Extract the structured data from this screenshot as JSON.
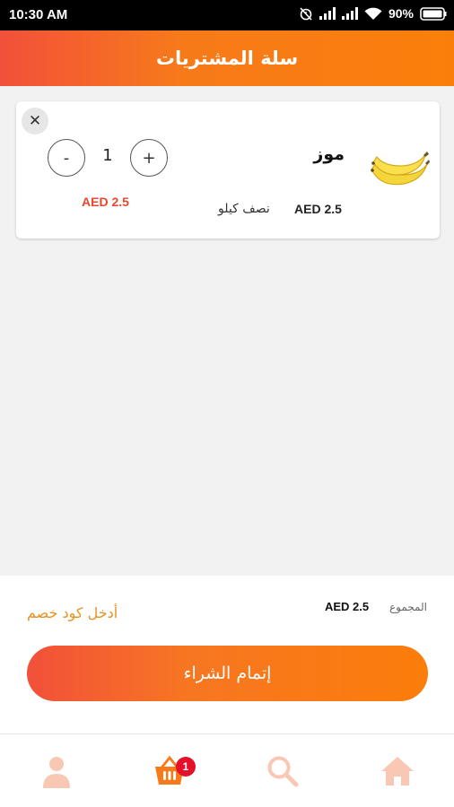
{
  "status_bar": {
    "time": "10:30 AM",
    "battery": "90%"
  },
  "header": {
    "title": "سلة المشتريات"
  },
  "cart": {
    "items": [
      {
        "name": "موز",
        "unit": "نصف كيلو",
        "unit_price": "AED 2.5",
        "quantity": "1",
        "total": "AED 2.5",
        "image_icon": "banana-image",
        "remove_symbol": "✕",
        "minus_symbol": "-",
        "plus_symbol": "+"
      }
    ]
  },
  "summary": {
    "total_label": "المجموع",
    "total_value": "AED 2.5",
    "coupon_link": "أدخل كود خصم",
    "checkout_label": "إتمام الشراء"
  },
  "bottom_nav": {
    "items": [
      {
        "icon": "profile-icon"
      },
      {
        "icon": "cart-icon",
        "badge": "1"
      },
      {
        "icon": "search-icon"
      },
      {
        "icon": "home-icon"
      }
    ],
    "active_color": "#f77a1a",
    "inactive_color": "#f9c8b4"
  },
  "colors": {
    "accent": "#f77a1a",
    "accent_start": "#f2503a",
    "price_red": "#e8472e",
    "coupon_orange": "#e59324",
    "badge_red": "#e5102a"
  }
}
